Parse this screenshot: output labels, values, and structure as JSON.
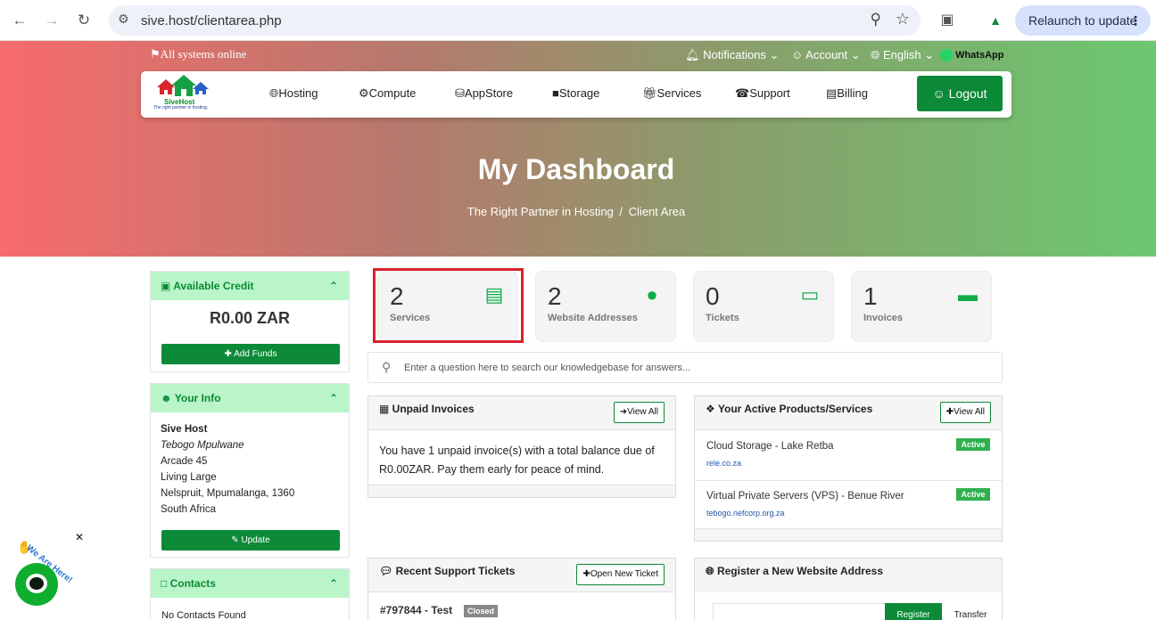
{
  "browser": {
    "url": "sive.host/clientarea.php",
    "relaunch_label": "Relaunch to update"
  },
  "topbar": {
    "status": "All systems online",
    "notifications": "Notifications",
    "account": "Account",
    "language": "English",
    "whatsapp": "WhatsApp"
  },
  "logo": {
    "name": "SiveHost",
    "tagline": "The right partner in hosting."
  },
  "nav": {
    "items": [
      "Hosting",
      "Compute",
      "AppStore",
      "Storage",
      "Services",
      "Support",
      "Billing"
    ],
    "logout": "Logout"
  },
  "hero": {
    "title": "My Dashboard",
    "crumb_home": "The Right Partner in Hosting",
    "crumb_sep": "/",
    "crumb_current": "Client Area"
  },
  "credit": {
    "title": "Available Credit",
    "amount": "R0.00 ZAR",
    "button": "Add Funds"
  },
  "info": {
    "title": "Your Info",
    "company": "Sive Host",
    "name": "Tebogo Mpulwane",
    "lines": [
      "Arcade 45",
      "Living Large",
      "Nelspruit, Mpumalanga, 1360",
      "South Africa"
    ],
    "button": "Update"
  },
  "contacts": {
    "title": "Contacts",
    "empty": "No Contacts Found"
  },
  "stats": [
    {
      "num": "2",
      "label": "Services",
      "icon": "server-icon"
    },
    {
      "num": "2",
      "label": "Website Addresses",
      "icon": "globe-icon"
    },
    {
      "num": "0",
      "label": "Tickets",
      "icon": "ticket-icon"
    },
    {
      "num": "1",
      "label": "Invoices",
      "icon": "credit-card-icon"
    }
  ],
  "kb": {
    "placeholder": "Enter a question here to search our knowledgebase for answers..."
  },
  "invoices": {
    "title": "Unpaid Invoices",
    "view_all": "View All",
    "message": "You have 1 unpaid invoice(s) with a total balance due of R0.00ZAR. Pay them early for peace of mind."
  },
  "products": {
    "title": "Your Active Products/Services",
    "view_all": "View All",
    "items": [
      {
        "name": "Cloud Storage - Lake Retba",
        "domain": "rele.co.za",
        "status": "Active"
      },
      {
        "name": "Virtual Private Servers (VPS) - Benue River",
        "domain": "tebogo.nefcorp.org.za",
        "status": "Active"
      }
    ]
  },
  "tickets": {
    "title": "Recent Support Tickets",
    "button": "Open New Ticket",
    "ticket_id": "#797844 - Test",
    "ticket_status": "Closed"
  },
  "domains": {
    "title": "Register a New Website Address",
    "register": "Register",
    "transfer": "Transfer"
  },
  "chat": {
    "label": "We Are Here!"
  },
  "colors": {
    "green": "#0c8a38",
    "light_green": "#b9f5c9",
    "red_highlight": "#d9212c"
  }
}
